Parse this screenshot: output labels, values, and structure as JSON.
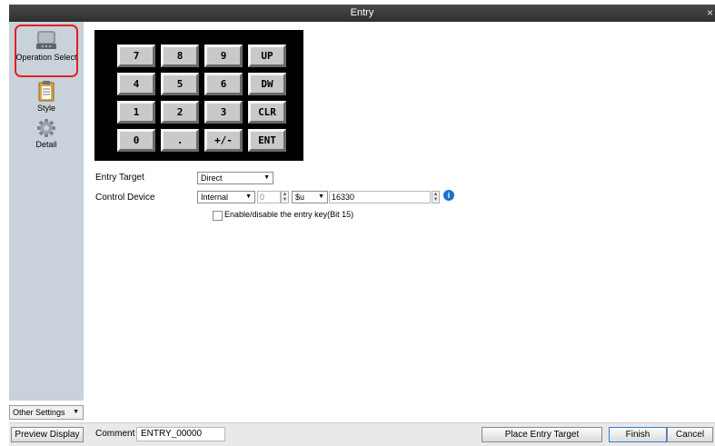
{
  "window": {
    "title": "Entry",
    "close_glyph": "×"
  },
  "sidebar": {
    "items": [
      {
        "label": "Operation Select",
        "icon": "operation-select-icon",
        "selected": true
      },
      {
        "label": "Style",
        "icon": "style-icon"
      },
      {
        "label": "Detail",
        "icon": "detail-icon"
      }
    ],
    "other_settings": "Other Settings"
  },
  "keypad": {
    "rows": [
      [
        "7",
        "8",
        "9",
        "UP"
      ],
      [
        "4",
        "5",
        "6",
        "DW"
      ],
      [
        "1",
        "2",
        "3",
        "CLR"
      ],
      [
        "0",
        ".",
        "+/-",
        "ENT"
      ]
    ]
  },
  "form": {
    "entry_target_label": "Entry Target",
    "entry_target_value": "Direct",
    "control_device_label": "Control Device",
    "device_type": "Internal",
    "device_index": "0",
    "device_prefix": "$u",
    "device_address": "16330",
    "enable_checkbox_label": "Enable/disable the entry key(Bit 15)",
    "enable_checked": false
  },
  "footer": {
    "preview_label": "Preview Display",
    "comment_label": "Comment",
    "comment_value": "ENTRY_00000",
    "place_label": "Place Entry Target",
    "finish_label": "Finish",
    "cancel_label": "Cancel"
  },
  "colors": {
    "selection_highlight": "#e0231d",
    "sidebar_bg": "#c9d1da",
    "title_bg": "#3a3a3a",
    "info": "#1f6fd0"
  }
}
